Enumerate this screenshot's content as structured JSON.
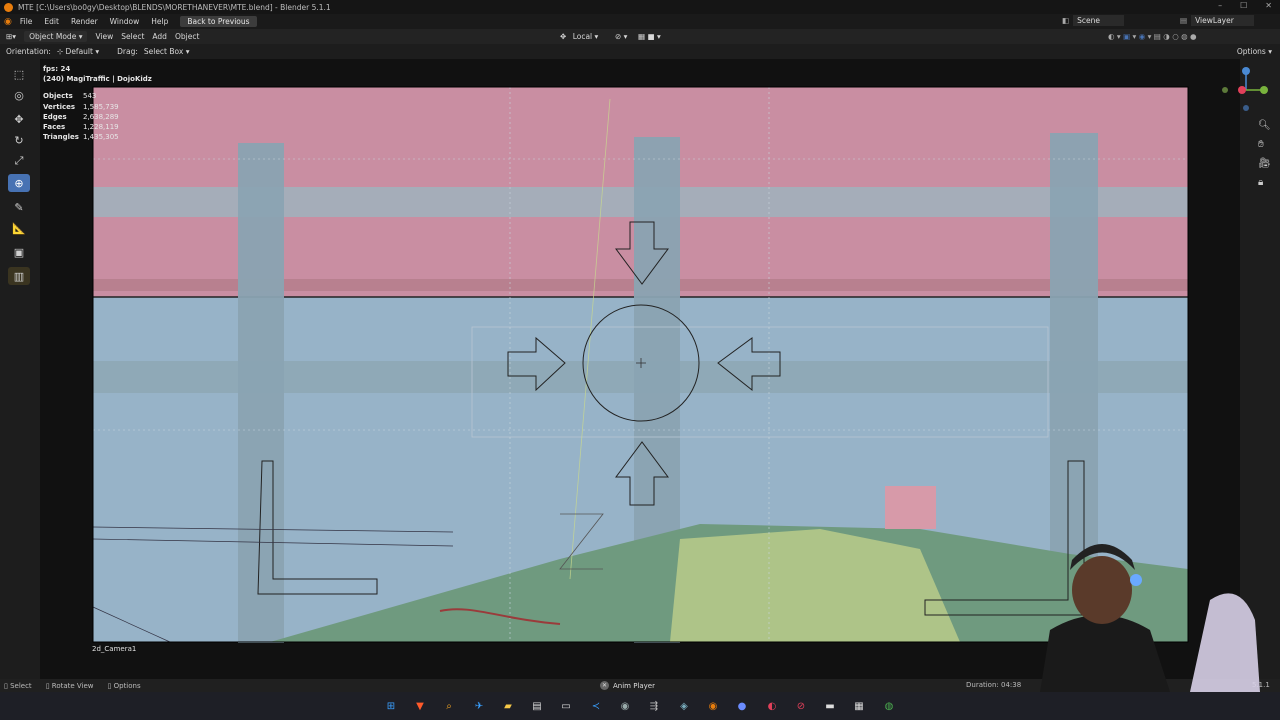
{
  "window": {
    "title": "MTE [C:\\Users\\bo0gy\\Desktop\\BLENDS\\MORETHANEVER\\MTE.blend] - Blender 5.1.1",
    "controls": [
      "–",
      "☐",
      "✕"
    ]
  },
  "menubar": {
    "items": [
      "File",
      "Edit",
      "Render",
      "Window",
      "Help"
    ],
    "back_button": "Back to Previous",
    "scene_label": "Scene",
    "viewlayer_label": "ViewLayer"
  },
  "toolbar": {
    "mode": "Object Mode",
    "menus": [
      "View",
      "Select",
      "Add",
      "Object"
    ],
    "transform_pivot": "Local"
  },
  "header2": {
    "orientation_label": "Orientation:",
    "orientation_value": "Default",
    "drag_label": "Drag:",
    "drag_value": "Select Box",
    "options_label": "Options"
  },
  "viewport": {
    "fps": "fps: 24",
    "frame_info": "(240) MagiTraffic | DojoKidz",
    "stats": [
      {
        "k": "Objects",
        "v": "543"
      },
      {
        "k": "Vertices",
        "v": "1,585,739"
      },
      {
        "k": "Edges",
        "v": "2,638,289"
      },
      {
        "k": "Faces",
        "v": "1,228,119"
      },
      {
        "k": "Triangles",
        "v": "1,435,305"
      }
    ],
    "camera_name": "2d_Camera1"
  },
  "colors": {
    "sky_pink": "#c98ea2",
    "wall_blue": "#97b3c8",
    "pillar": "#8aa3b2",
    "floor_green": "#6f9a7f",
    "car_yellow": "#b5c98a",
    "accent": "#4772b3"
  },
  "statusbar": {
    "select": "Select",
    "rotate": "Rotate View",
    "options": "Options",
    "anim_player": "Anim Player",
    "duration": "Duration: 04:38",
    "version": "5.1.1"
  }
}
